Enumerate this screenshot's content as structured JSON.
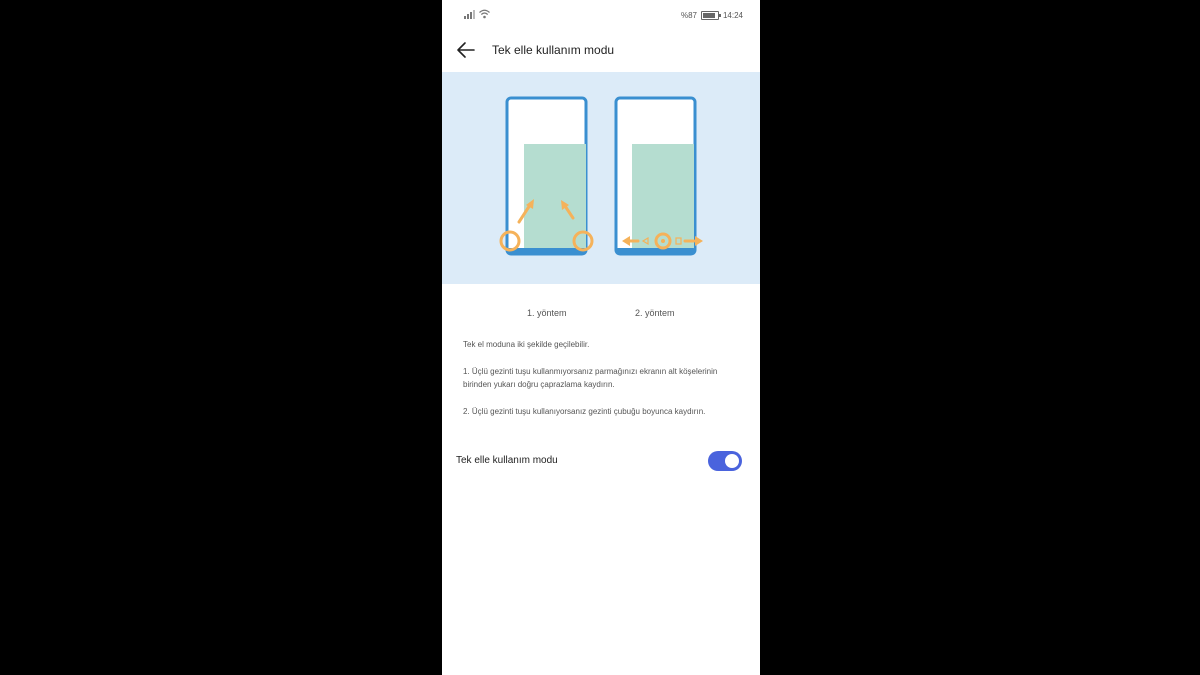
{
  "status_bar": {
    "battery_percent": "%87",
    "battery_level": 0.87,
    "time": "14:24"
  },
  "header": {
    "back_icon": "arrow-left-icon",
    "title": "Tek elle kullanım modu"
  },
  "illustration": {
    "phone_outline_color": "#3a8fd0",
    "content_color": "#b5ddd0",
    "gesture_color": "#f5b25a",
    "background": "#dcebf8"
  },
  "methods": {
    "method_1": "1. yöntem",
    "method_2": "2. yöntem"
  },
  "description": {
    "intro": "Tek el moduna iki şekilde geçilebilir.",
    "step_1": "1. Üçlü gezinti tuşu kullanmıyorsanız parmağınızı ekranın alt köşelerinin birinden yukarı doğru çaprazlama kaydırın.",
    "step_2": "2. Üçlü gezinti tuşu kullanıyorsanız gezinti çubuğu boyunca kaydırın."
  },
  "setting": {
    "label": "Tek elle kullanım modu",
    "enabled": true,
    "accent_color": "#4a63dd"
  }
}
